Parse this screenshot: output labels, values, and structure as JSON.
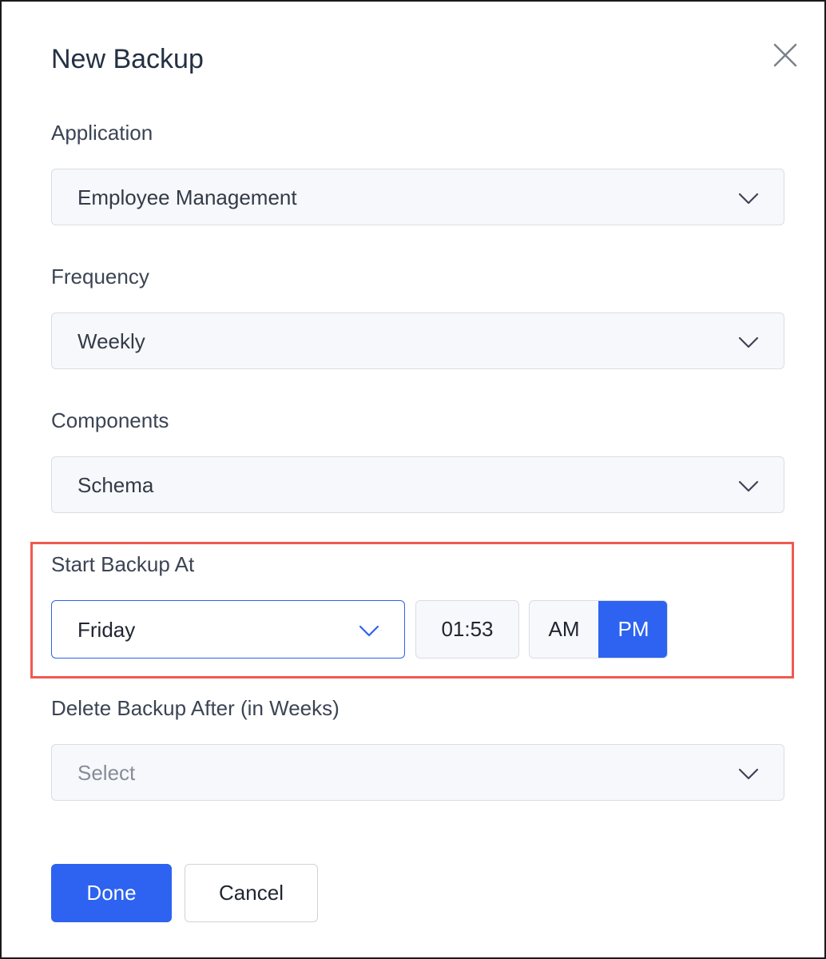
{
  "dialog": {
    "title": "New Backup"
  },
  "fields": {
    "application": {
      "label": "Application",
      "value": "Employee Management"
    },
    "frequency": {
      "label": "Frequency",
      "value": "Weekly"
    },
    "components": {
      "label": "Components",
      "value": "Schema"
    },
    "start_backup": {
      "label": "Start Backup At",
      "day": "Friday",
      "time": "01:53",
      "am_label": "AM",
      "pm_label": "PM",
      "selected_period": "PM"
    },
    "delete_after": {
      "label": "Delete Backup After (in Weeks)",
      "placeholder": "Select"
    }
  },
  "buttons": {
    "done": "Done",
    "cancel": "Cancel"
  },
  "icons": {
    "close": "close-icon",
    "dropdown": "chevron-down-icon"
  },
  "colors": {
    "accent": "#2d63f0",
    "highlight_border": "#ef5a4f"
  }
}
